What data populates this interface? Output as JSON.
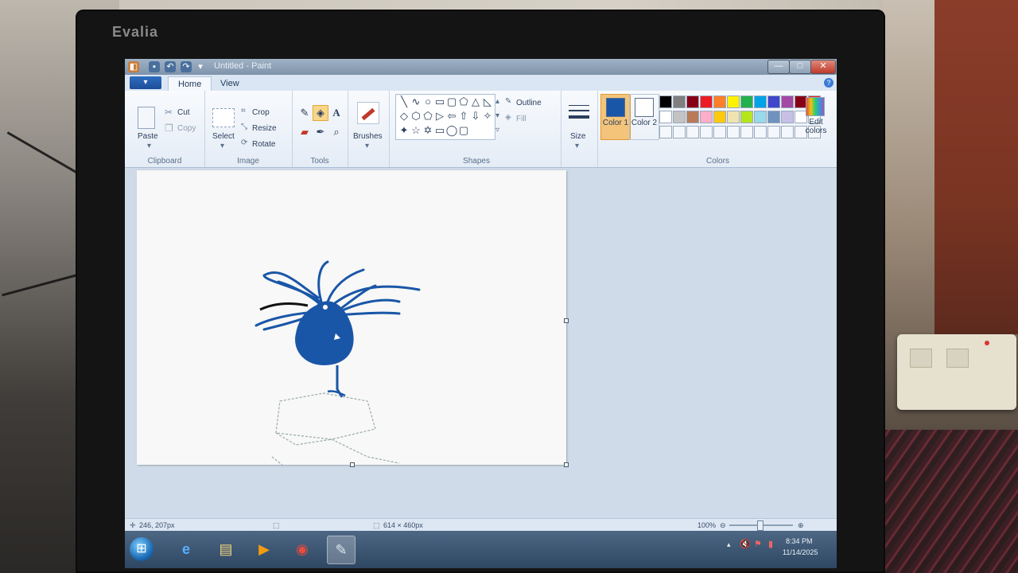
{
  "monitor": {
    "brand": "Evalia"
  },
  "window": {
    "title": "Untitled - Paint",
    "controls": {
      "minimize": "—",
      "maximize": "□",
      "close": "✕"
    }
  },
  "tabs": {
    "file": "▾",
    "home": "Home",
    "view": "View",
    "help": "?"
  },
  "ribbon": {
    "clipboard": {
      "label": "Clipboard",
      "paste": "Paste",
      "cut": "Cut",
      "copy": "Copy"
    },
    "image": {
      "label": "Image",
      "select": "Select",
      "crop": "Crop",
      "resize": "Resize",
      "rotate": "Rotate"
    },
    "tools": {
      "label": "Tools",
      "text_tool": "A"
    },
    "brushes": {
      "label": "Brushes"
    },
    "shapes": {
      "label": "Shapes",
      "items": [
        "╲",
        "∿",
        "○",
        "▭",
        "▢",
        "⬠",
        "△",
        "◺",
        "◇",
        "⬡",
        "⬠",
        "▷",
        "⇦",
        "⇧",
        "⇩",
        "✧",
        "✦",
        "☆",
        "✡",
        "▭",
        "◯",
        "▢"
      ],
      "outline": "Outline",
      "fill": "Fill"
    },
    "size": {
      "label": "Size"
    },
    "colors": {
      "label": "Colors",
      "color1": "Color 1",
      "color2": "Color 2",
      "color1_value": "#1a56a8",
      "color2_value": "#ffffff",
      "edit": "Edit colors",
      "palette_row1": [
        "#000000",
        "#7f7f7f",
        "#880015",
        "#ed1c24",
        "#ff7f27",
        "#fff200",
        "#22b14c",
        "#00a2e8",
        "#3f48cc",
        "#a349a4",
        "#880015",
        "#ed1c24"
      ],
      "palette_row2": [
        "#ffffff",
        "#c3c3c3",
        "#b97a57",
        "#ffaec9",
        "#ffc90e",
        "#efe4b0",
        "#b5e61d",
        "#99d9ea",
        "#7092be",
        "#c8bfe7",
        "#ffffff",
        "#ffffff"
      ]
    }
  },
  "status": {
    "cursor": "246, 207px",
    "size": "614 × 460px",
    "zoom": "100%"
  },
  "taskbar": {
    "time": "8:34 PM",
    "date": "11/14/2025"
  }
}
